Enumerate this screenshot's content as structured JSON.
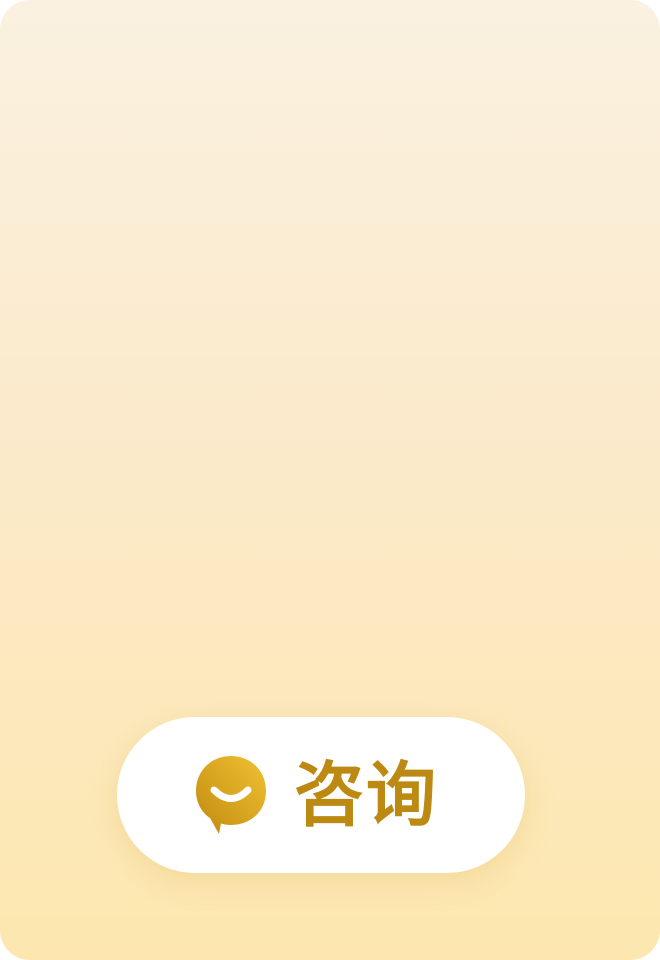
{
  "consult_button": {
    "label": "咨询",
    "icon": "chat-bubble-smile-icon"
  },
  "colors": {
    "background_top": "#FAF1E0",
    "background_bottom": "#FDE7AF",
    "button_background": "#FFFFFF",
    "label_color": "#BC8A12",
    "icon_gold_light": "#F1C233",
    "icon_gold_dark": "#C08A0E"
  }
}
